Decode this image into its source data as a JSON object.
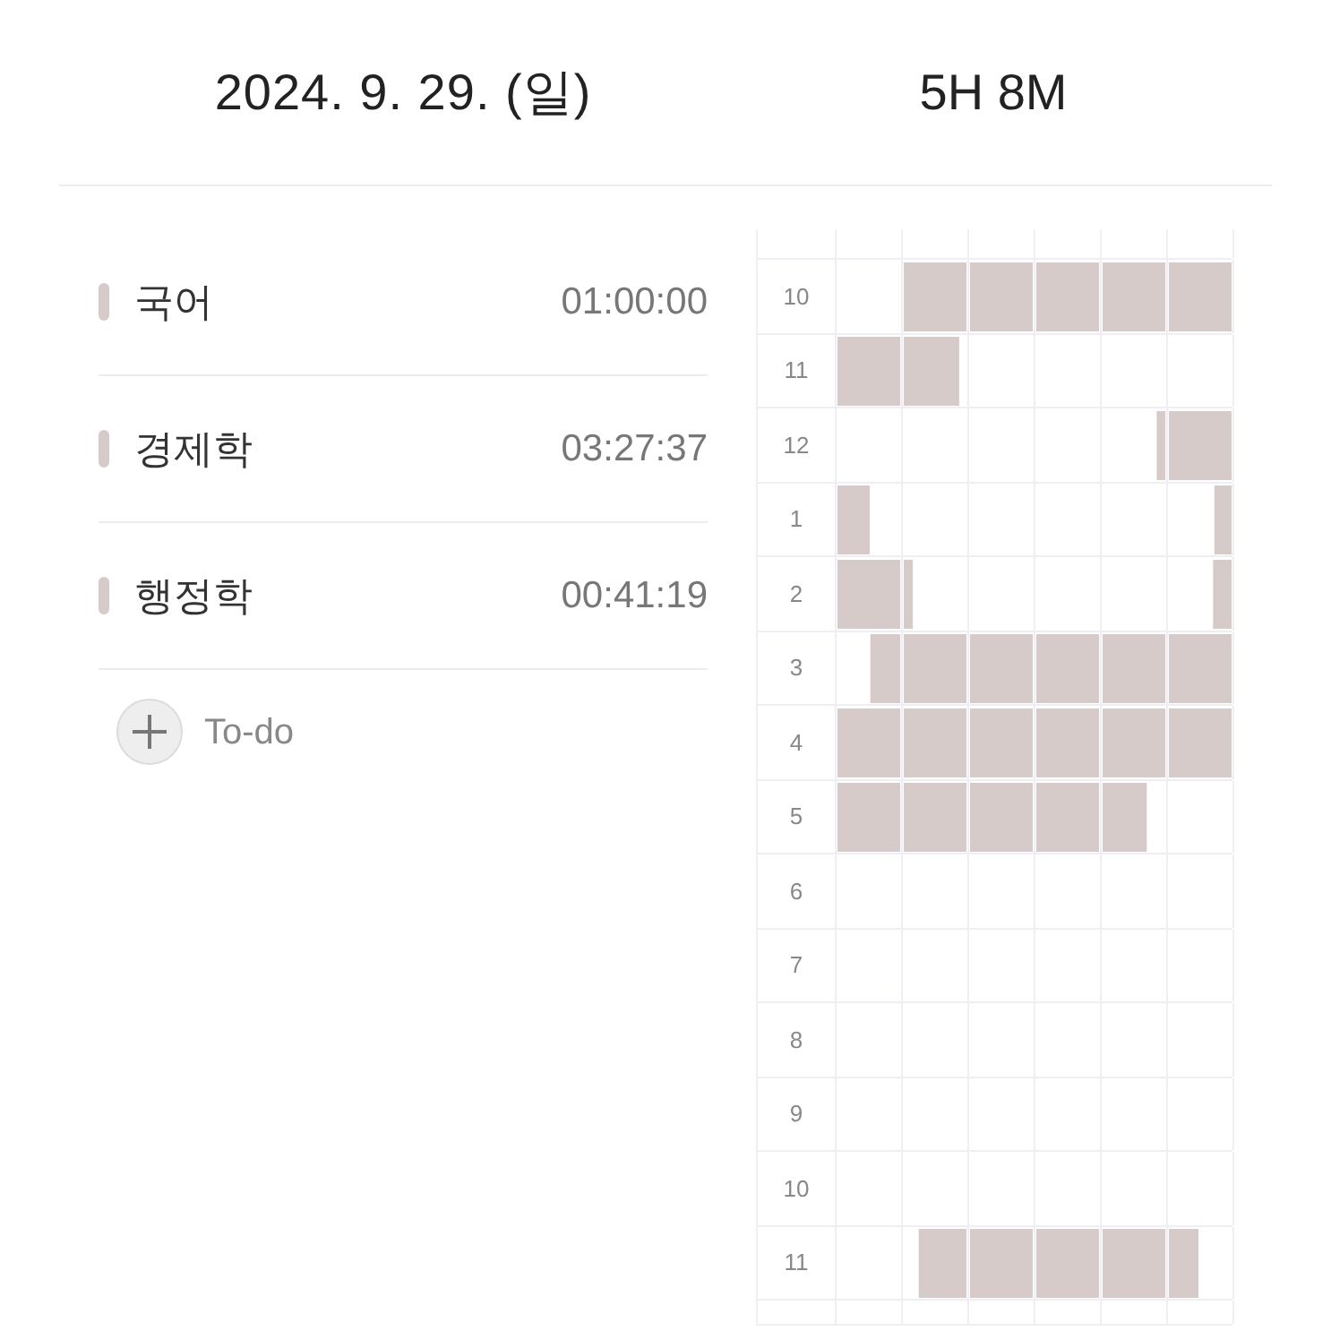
{
  "header": {
    "date": "2024. 9. 29. (일)",
    "total": "5H 8M"
  },
  "subjects": [
    {
      "name": "국어",
      "time": "01:00:00"
    },
    {
      "name": "경제학",
      "time": "03:27:37"
    },
    {
      "name": "행정학",
      "time": "00:41:19"
    }
  ],
  "add_button": {
    "label": "To-do"
  },
  "timeline": [
    {
      "hour": "10"
    },
    {
      "hour": "11"
    },
    {
      "hour": "12"
    },
    {
      "hour": "1"
    },
    {
      "hour": "2"
    },
    {
      "hour": "3"
    },
    {
      "hour": "4"
    },
    {
      "hour": "5"
    },
    {
      "hour": "6"
    },
    {
      "hour": "7"
    },
    {
      "hour": "8"
    },
    {
      "hour": "9"
    },
    {
      "hour": "10"
    },
    {
      "hour": "11"
    }
  ]
}
